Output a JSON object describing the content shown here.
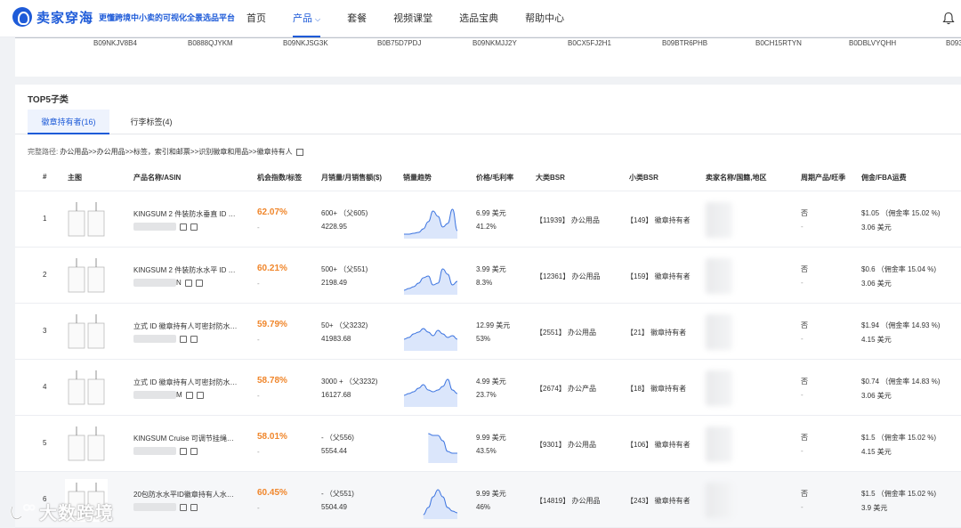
{
  "brand": {
    "name": "卖家穿海",
    "slogan": "更懂跨境中小卖的可视化全景选品平台",
    "color": "#1e5bd8"
  },
  "nav": {
    "items": [
      "首页",
      "产品",
      "套餐",
      "视频课堂",
      "选品宝典",
      "帮助中心"
    ],
    "active": "产品"
  },
  "asin_strip": [
    "B09NKJV8B4",
    "B0888QJYKM",
    "B09NKJSG3K",
    "B0B75D7PDJ",
    "B09NKMJJ2Y",
    "B0CX5FJ2H1",
    "B09BTR6PHB",
    "B0CH15RTYN",
    "B0DBLVYQHH",
    "B093"
  ],
  "section": {
    "title": "TOP5子类",
    "tabs": [
      "徽章持有者(16)",
      "行李标签(4)"
    ],
    "path_label": "完整路径:",
    "path": "办公用品>>办公用品>>标签，索引和邮票>>识别徽章和用品>>徽章持有人"
  },
  "table": {
    "headers": [
      "#",
      "主图",
      "产品名称/ASIN",
      "机会指数/标签",
      "月销量/月销售额($)",
      "销量趋势",
      "价格/毛利率",
      "大类BSR",
      "小类BSR",
      "卖家名称/国籍,地区",
      "周期产品/旺季",
      "佣金/FBA运费"
    ],
    "rows": [
      {
        "index": "1",
        "name": "KINGSUM 2 件装防水垂直 ID …",
        "asin_tail": "",
        "score": "62.07%",
        "score_sub": "-",
        "sales": "600+ （父605)",
        "revenue": "4228.95",
        "price": "6.99 美元",
        "margin": "41.2%",
        "big_bsr": "【11939】 办公用品",
        "small_bsr": "【149】 徽章持有者",
        "periodic": "否",
        "season": "-",
        "commission": "$1.05 （佣金率 15.02 %)",
        "fba": "3.06 美元",
        "spark": [
          2,
          2,
          2.5,
          3,
          5,
          9,
          15,
          12,
          6,
          8,
          16,
          4
        ]
      },
      {
        "index": "2",
        "name": "KINGSUM 2 件装防水水平 ID …",
        "asin_tail": "N",
        "score": "60.21%",
        "score_sub": "-",
        "sales": "500+ （父551)",
        "revenue": "2198.49",
        "price": "3.99 美元",
        "margin": "8.3%",
        "big_bsr": "【12361】 办公用品",
        "small_bsr": "【159】 徽章持有者",
        "periodic": "否",
        "season": "-",
        "commission": "$0.6 （佣金率 15.04 %)",
        "fba": "3.06 美元",
        "spark": [
          2,
          3,
          4,
          6,
          9,
          10,
          5,
          6,
          14,
          11,
          5,
          7
        ]
      },
      {
        "index": "3",
        "name": "立式 ID 徽章持有人可密封防水…",
        "asin_tail": "",
        "score": "59.79%",
        "score_sub": "-",
        "sales": "50+ （父3232)",
        "revenue": "41983.68",
        "price": "12.99 美元",
        "margin": "53%",
        "big_bsr": "【2551】 办公用品",
        "small_bsr": "【21】 徽章持有者",
        "periodic": "否",
        "season": "-",
        "commission": "$1.94 （佣金率 14.93 %)",
        "fba": "4.15 美元",
        "spark": [
          6,
          7,
          9,
          10,
          12,
          10,
          8,
          11,
          9,
          7,
          8,
          6
        ]
      },
      {
        "index": "4",
        "name": "立式 ID 徽章持有人可密封防水…",
        "asin_tail": "M",
        "score": "58.78%",
        "score_sub": "-",
        "sales": "3000 + （父3232)",
        "revenue": "16127.68",
        "price": "4.99 美元",
        "margin": "23.7%",
        "big_bsr": "【2674】 办公产品",
        "small_bsr": "【18】 徽章持有者",
        "periodic": "否",
        "season": "-",
        "commission": "$0.74 （佣金率 14.83 %)",
        "fba": "3.06 美元",
        "spark": [
          6,
          7,
          8,
          10,
          12,
          9,
          8,
          9,
          11,
          15,
          9,
          7
        ]
      },
      {
        "index": "5",
        "name": "KINGSUM Cruise 可调节挂绳…",
        "asin_tail": "",
        "score": "58.01%",
        "score_sub": "-",
        "sales": "- （父556)",
        "revenue": "5554.44",
        "price": "9.99 美元",
        "margin": "43.5%",
        "big_bsr": "【9301】 办公用品",
        "small_bsr": "【106】 徽章持有者",
        "periodic": "否",
        "season": "-",
        "commission": "$1.5 （佣金率 15.02 %)",
        "fba": "4.15 美元",
        "spark": [
          null,
          null,
          null,
          null,
          null,
          16,
          15,
          15,
          12,
          6,
          5,
          5
        ]
      },
      {
        "index": "6",
        "name": "20包防水水平ID徽章持有人水…",
        "asin_tail": "",
        "score": "60.45%",
        "score_sub": "-",
        "sales": "- （父551)",
        "revenue": "5504.49",
        "price": "9.99 美元",
        "margin": "46%",
        "big_bsr": "【14819】 办公用品",
        "small_bsr": "【243】 徽章持有者",
        "periodic": "否",
        "season": "-",
        "commission": "$1.5 （佣金率 15.02 %)",
        "fba": "3.9 美元",
        "spark": [
          null,
          null,
          null,
          null,
          2,
          6,
          12,
          16,
          12,
          6,
          4,
          3
        ]
      }
    ]
  },
  "watermark": "大数跨境"
}
